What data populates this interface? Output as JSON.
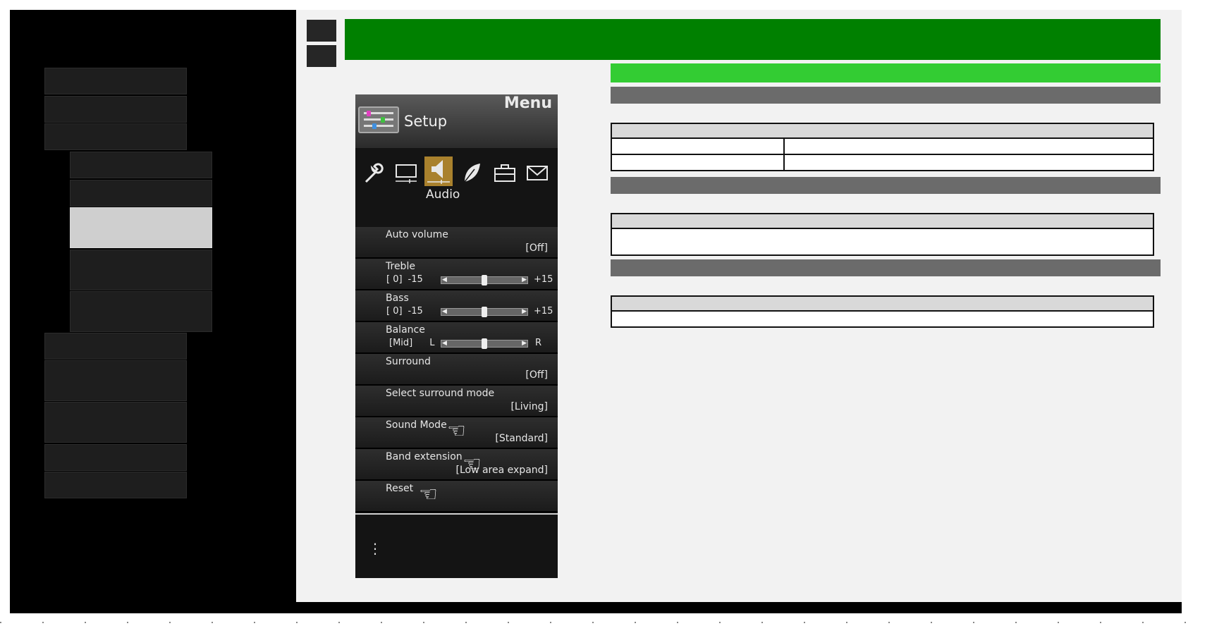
{
  "tv_menu": {
    "menu_title": "Menu",
    "section_title": "Setup",
    "active_tab": "Audio",
    "tab_icons": [
      "wrench-icon",
      "picture-icon",
      "speaker-icon",
      "leaf-icon",
      "toolbox-icon",
      "mail-icon"
    ],
    "items": [
      {
        "label": "Auto volume",
        "value": "[Off]"
      },
      {
        "label": "Treble",
        "slider_value": "[    0]",
        "min": "-15",
        "max": "+15",
        "position": 0.5
      },
      {
        "label": "Bass",
        "slider_value": "[    0]",
        "min": "-15",
        "max": "+15",
        "position": 0.5
      },
      {
        "label": "Balance",
        "slider_value": "[Mid]",
        "min": "L",
        "max": "R",
        "position": 0.5
      },
      {
        "label": "Surround",
        "value": "[Off]"
      },
      {
        "label": "Select surround mode",
        "value": "[Living]"
      },
      {
        "label": "Sound Mode",
        "value": "[Standard]"
      },
      {
        "label": "Band extension",
        "value": "[Low area expand]"
      },
      {
        "label": "Reset",
        "value": ""
      }
    ],
    "footer_glyph": "⋮"
  },
  "colors": {
    "title_bar": "#008000",
    "subtitle_bar": "#33cc33",
    "section_bar": "#6b6b6b",
    "selected_nav": "#cfcfcf"
  }
}
